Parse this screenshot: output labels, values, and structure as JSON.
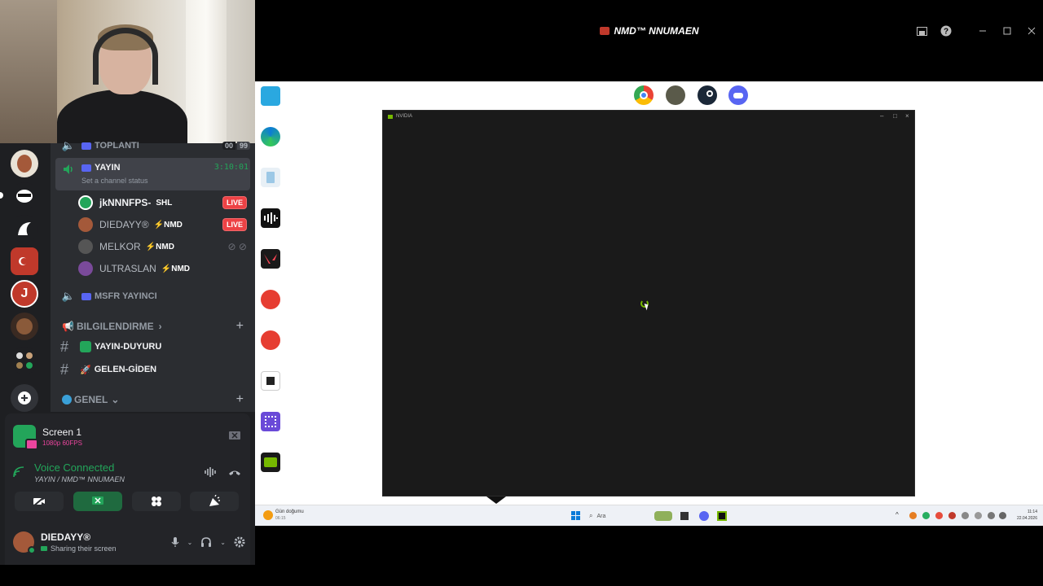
{
  "window": {
    "title": "NMD™ NNUMAEN"
  },
  "channels": {
    "partial_top": {
      "name": "TOPLANTI",
      "counter_a": "00",
      "counter_b": "99"
    },
    "active_voice": {
      "name": "YAYIN",
      "timer": "3:10:01",
      "status_placeholder": "Set a channel status"
    },
    "users": [
      {
        "name": "jkNNNFPS-",
        "tag": "SHL",
        "live": "LIVE",
        "avatar_color": "#23a55a"
      },
      {
        "name": "DIEDAYY®",
        "tag": "NMD",
        "live": "LIVE",
        "avatar_color": "#a4593a"
      },
      {
        "name": "MELKOR",
        "tag": "NMD",
        "live": "",
        "avatar_color": "#555555"
      },
      {
        "name": "ULTRASLAN",
        "tag": "NMD",
        "live": "",
        "avatar_color": "#7a4a9a"
      }
    ],
    "second_voice": {
      "name": "MSFR YAYINCI"
    },
    "category_1": {
      "name": "BILGILENDIRME",
      "chevron": "›"
    },
    "text_channels": [
      {
        "name": "YAYIN-DUYURU",
        "emoji_color": "#23a55a"
      },
      {
        "name": "GELEN-GİDEN",
        "emoji_color": "#e74c3c"
      }
    ],
    "category_2": {
      "name": "GENEL",
      "chevron": "⌄"
    }
  },
  "stream_card": {
    "title": "Screen 1",
    "quality": "1080p 60FPS"
  },
  "voice": {
    "status": "Voice Connected",
    "channel": "YAYIN / NMD™ NNUMAEN"
  },
  "user_panel": {
    "name": "DIEDAYY®",
    "status": "Sharing their screen"
  },
  "shared_screen": {
    "nvidia_window_title": "NVIDIA",
    "weather_text": "Gün doğumu",
    "weather_time": "06:15",
    "search_placeholder": "Ara",
    "clock_time": "11:14",
    "clock_date": "22.04.2026"
  },
  "colors": {
    "discord_bg": "#1e1f22",
    "channel_bg": "#2b2d31",
    "accent_green": "#23a55a",
    "live_red": "#ed4245",
    "nvidia_green": "#76b900"
  },
  "icons": {
    "servers": [
      "server-avatar-1",
      "server-mask",
      "server-dragon",
      "server-flag",
      "server-red-logo",
      "server-face",
      "server-group",
      "add-server-icon"
    ],
    "top_apps": [
      "chrome-icon",
      "pubg-icon",
      "steam-icon",
      "discord-icon"
    ],
    "desktop": [
      "monitor-icon",
      "edge-icon",
      "recycle-bin-icon",
      "audio-app-icon",
      "valorant-icon",
      "faceit-icon",
      "faceit-icon-2",
      "app-icon",
      "grid-app-icon",
      "nvidia-icon"
    ]
  }
}
